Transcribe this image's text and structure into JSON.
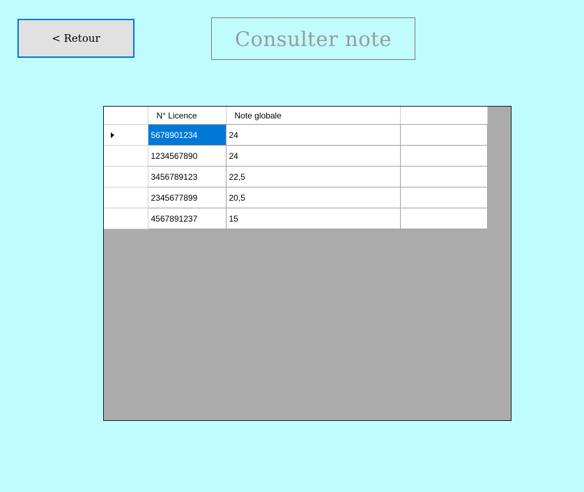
{
  "back_button": {
    "label": "< Retour"
  },
  "title": "Consulter note",
  "grid": {
    "columns": [
      "N° Licence",
      "Note globale",
      ""
    ],
    "rows": [
      {
        "licence": "5678901234",
        "note": "24",
        "extra": "",
        "current": true,
        "selected_cell": "licence"
      },
      {
        "licence": "1234567890",
        "note": "24",
        "extra": ""
      },
      {
        "licence": "3456789123",
        "note": "22,5",
        "extra": ""
      },
      {
        "licence": "2345677899",
        "note": "20,5",
        "extra": ""
      },
      {
        "licence": "4567891237",
        "note": "15",
        "extra": ""
      }
    ]
  },
  "colors": {
    "background": "#c0fcfe",
    "selection": "#0078d7",
    "grid_empty_area": "#ababab",
    "button_border": "#0078d7"
  },
  "icons": {
    "current_row": "row-pointer-icon"
  }
}
